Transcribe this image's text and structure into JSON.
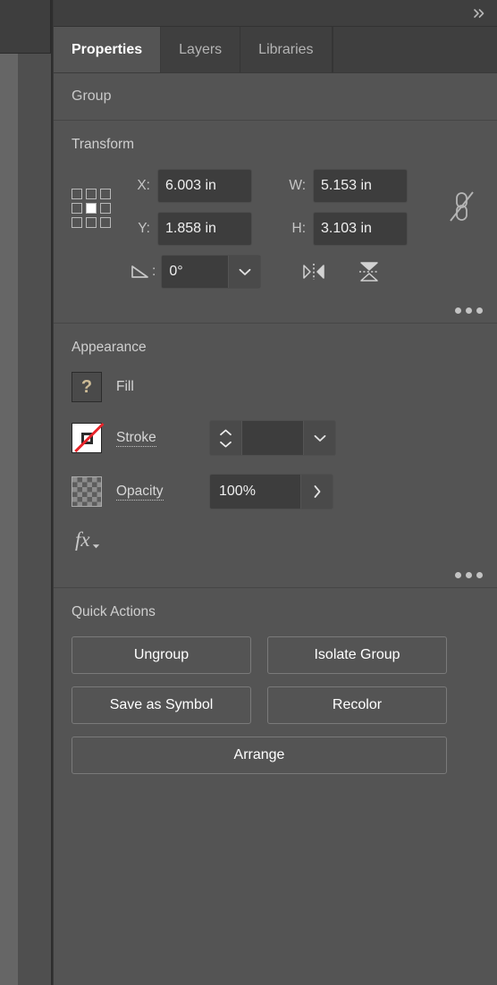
{
  "app": {
    "panel_header": {
      "collapse_icon": "double-chevron-right-icon"
    },
    "tabs": [
      {
        "label": "Properties",
        "active": true
      },
      {
        "label": "Layers",
        "active": false
      },
      {
        "label": "Libraries",
        "active": false
      }
    ],
    "object_type": "Group"
  },
  "transform": {
    "title": "Transform",
    "reference_point": {
      "icon": "reference-point-grid-icon",
      "selected": "center"
    },
    "x_label": "X:",
    "x_value": "6.003 in",
    "y_label": "Y:",
    "y_value": "1.858 in",
    "w_label": "W:",
    "w_value": "5.153 in",
    "h_label": "H:",
    "h_value": "3.103 in",
    "angle_label": ":",
    "angle_icon": "rotate-angle-icon",
    "angle_value": "0°",
    "angle_dropdown_icon": "chevron-down-icon",
    "flip_horizontal_icon": "flip-horizontal-icon",
    "flip_vertical_icon": "flip-vertical-icon",
    "link_icon": "unlink-broken-chain-icon",
    "menu_icon": "more-options-icon"
  },
  "appearance": {
    "title": "Appearance",
    "fill_label": "Fill",
    "fill_swatch_icon": "fill-mixed-question-swatch",
    "fill_swatch_value": "?",
    "stroke_label": "Stroke",
    "stroke_swatch_icon": "stroke-none-swatch",
    "stroke_weight_value": "",
    "stroke_weight_placeholder": "",
    "stroke_stepper_icon": "stepper-up-down-icon",
    "stroke_dropdown_icon": "chevron-down-icon",
    "opacity_label": "Opacity",
    "opacity_swatch_icon": "transparency-checkerboard-swatch",
    "opacity_value": "100%",
    "opacity_expand_icon": "chevron-right-icon",
    "fx_label": "fx",
    "fx_icon": "effects-fx-icon",
    "menu_icon": "more-options-icon"
  },
  "quick_actions": {
    "title": "Quick Actions",
    "buttons": [
      {
        "label": "Ungroup",
        "size": "half"
      },
      {
        "label": "Isolate Group",
        "size": "half"
      },
      {
        "label": "Save as Symbol",
        "size": "half"
      },
      {
        "label": "Recolor",
        "size": "half"
      },
      {
        "label": "Arrange",
        "size": "full"
      }
    ]
  },
  "colors": {
    "panel_bg": "#545454",
    "field_bg": "#3d3d3d",
    "tab_inactive_bg": "#3f3f3f",
    "text_primary": "#ffffff",
    "text_secondary": "#c6c6c6",
    "stroke_none_red": "#e8242a",
    "fill_question_tan": "#cdbb96"
  }
}
